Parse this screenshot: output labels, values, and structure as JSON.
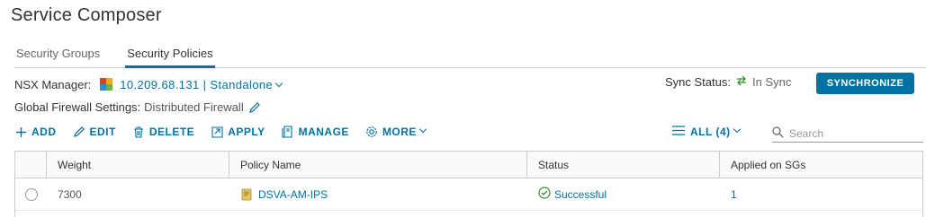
{
  "page": {
    "title": "Service Composer"
  },
  "tabs": [
    {
      "label": "Security Groups",
      "active": false
    },
    {
      "label": "Security Policies",
      "active": true
    }
  ],
  "nsx_manager": {
    "label": "NSX Manager:",
    "value": "10.209.68.131 | Standalone",
    "icon": "nsx-manager-icon"
  },
  "sync": {
    "label": "Sync Status:",
    "state": "In Sync",
    "button": "SYNCHRONIZE"
  },
  "firewall": {
    "label": "Global Firewall Settings:",
    "value": "Distributed Firewall"
  },
  "toolbar": {
    "add": "ADD",
    "edit": "EDIT",
    "delete": "DELETE",
    "apply": "APPLY",
    "manage": "MANAGE",
    "more": "MORE"
  },
  "filter": {
    "label": "ALL (4)"
  },
  "search": {
    "placeholder": "Search"
  },
  "table": {
    "columns": [
      "Weight",
      "Policy Name",
      "Status",
      "Applied on SGs"
    ],
    "rows": [
      {
        "weight": "7300",
        "policy_name": "DSVA-AM-IPS",
        "status": "Successful",
        "applied_on_sgs": "1"
      }
    ]
  },
  "colors": {
    "accent": "#0072a3",
    "success": "#3c8c2f"
  }
}
